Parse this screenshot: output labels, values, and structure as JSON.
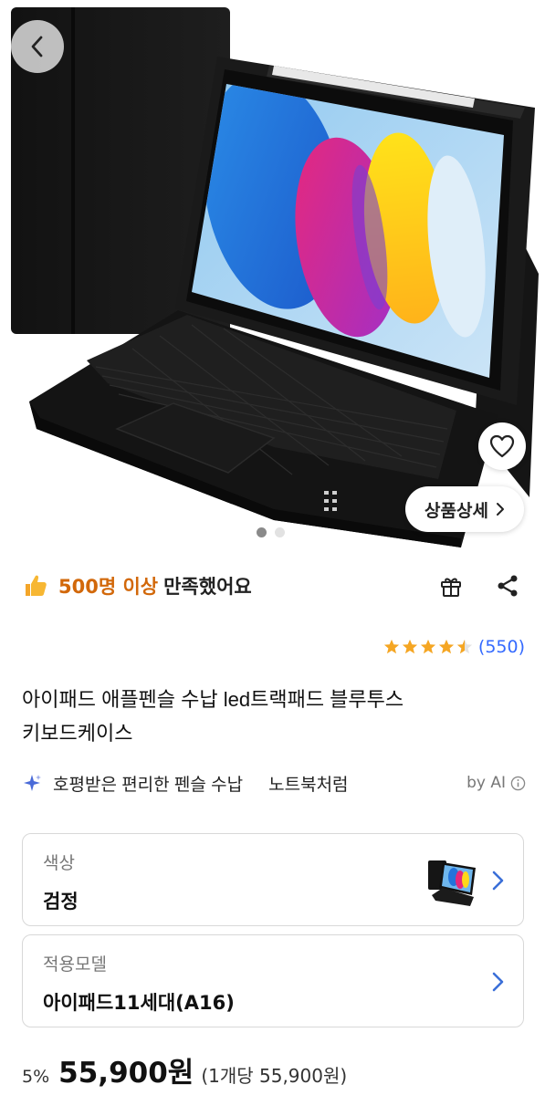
{
  "hero": {
    "detail_button_label": "상품상세",
    "image_count": 2,
    "active_image_index": 1
  },
  "satisfaction": {
    "icon": "thumbs-up-icon",
    "count_text": "500명 이상",
    "rest_text": "만족했어요"
  },
  "rating": {
    "stars": 4.5,
    "count_text": "(550)",
    "star_color": "#f5a623"
  },
  "product": {
    "title_line1": "아이패드 애플펜슬 수납 led트랙패드 블루투스",
    "title_line2": "키보드케이스"
  },
  "keywords": {
    "items": [
      "호평받은 편리한 펜슬 수납",
      "노트북처럼"
    ],
    "by_ai_label": "by AI"
  },
  "options": [
    {
      "label": "색상",
      "value": "검정",
      "has_thumbnail": true
    },
    {
      "label": "적용모델",
      "value": "아이패드11세대(A16)",
      "has_thumbnail": false
    }
  ],
  "price": {
    "discount": "5%",
    "amount": "55,900원",
    "unit_price": "(1개당 55,900원)"
  },
  "colors": {
    "accent_orange": "#d2680a",
    "link_blue": "#346aff",
    "chevron_blue": "#3a6fd8"
  }
}
